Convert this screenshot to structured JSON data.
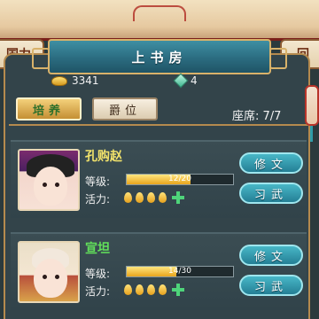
{
  "header": {
    "title": "上书房",
    "left_tab": "国力",
    "right_tab": "回"
  },
  "currency": {
    "gold": "3341",
    "jade": "4"
  },
  "tabs": [
    {
      "label": "培养",
      "active": true
    },
    {
      "label": "爵位",
      "active": false
    }
  ],
  "seats": "座席: 7/7",
  "labels": {
    "level": "等级:",
    "energy": "活力:",
    "study": "修文",
    "martial": "习武"
  },
  "students": [
    {
      "name": "孔购赵",
      "level_text": "12/20",
      "level_fraction": 0.6,
      "energy_drops": 4,
      "name_color": "#f2e36b"
    },
    {
      "name": "宣坦",
      "level_text": "14/30",
      "level_fraction": 0.47,
      "energy_drops": 4,
      "name_color": "#62e05a"
    }
  ],
  "colors": {
    "accent_teal": "#247f95",
    "frame_gold": "#b58a4e",
    "energy_yellow": "#e6a11c",
    "plus_green": "#4ed47a"
  }
}
